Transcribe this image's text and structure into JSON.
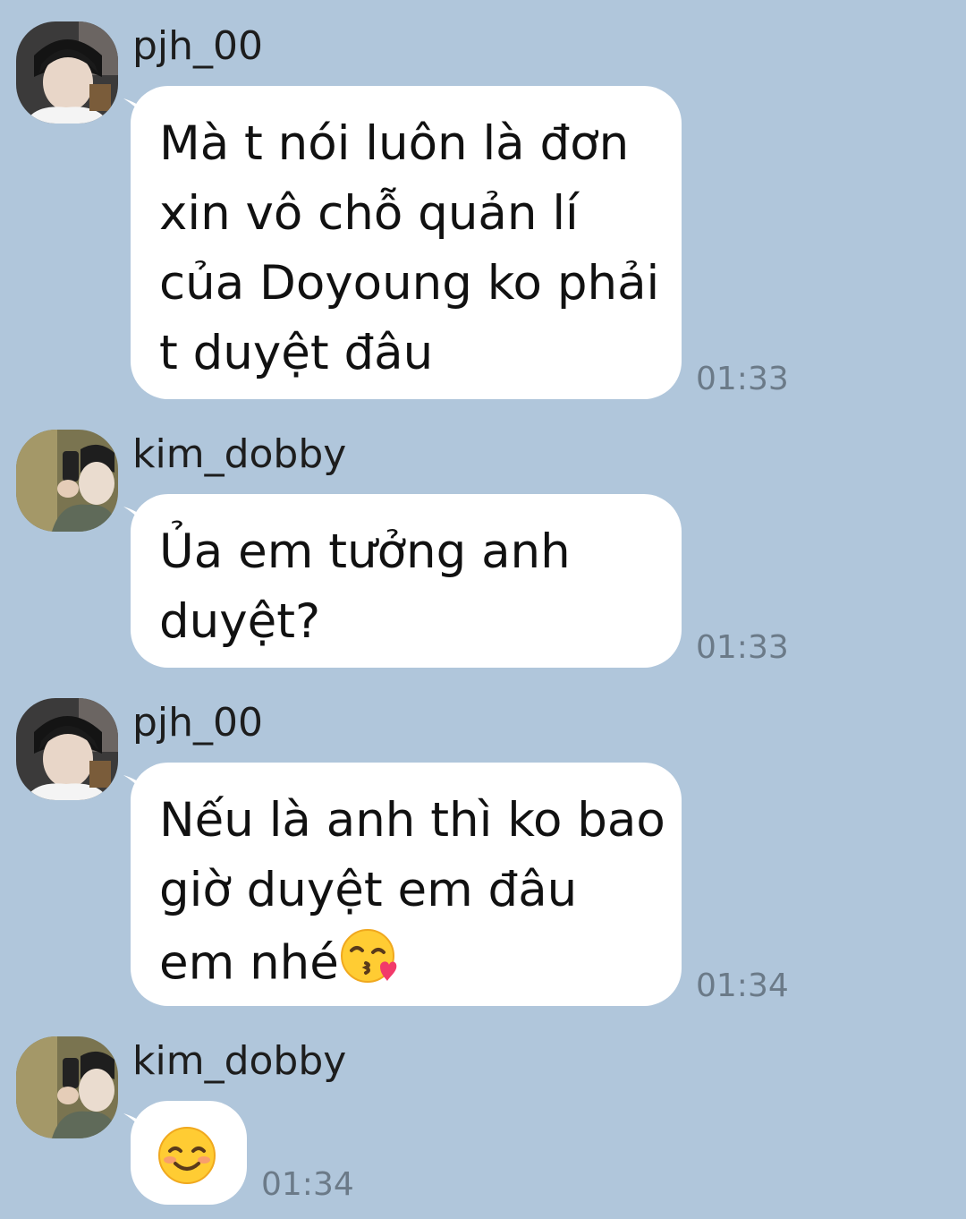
{
  "messages": [
    {
      "sender": "pjh_00",
      "lines": [
        "Mà t nói luôn là đơn",
        "xin vô chỗ quản lí",
        "của Doyoung ko phải",
        "t duyệt đâu"
      ],
      "time": "01:33"
    },
    {
      "sender": "kim_dobby",
      "lines": [
        "Ủa em tưởng anh",
        "duyệt?"
      ],
      "time": "01:33"
    },
    {
      "sender": "pjh_00",
      "lines": [
        "Nếu là anh thì ko bao",
        "giờ duyệt em đâu",
        "em nhé"
      ],
      "emoji": "kissing-face-with-heart",
      "time": "01:34"
    },
    {
      "sender": "kim_dobby",
      "emoji": "smiling-face-with-smiling-eyes",
      "time": "01:34"
    }
  ],
  "colors": {
    "background": "#b0c6db",
    "bubble": "#ffffff",
    "time_text": "#6b7a88"
  }
}
